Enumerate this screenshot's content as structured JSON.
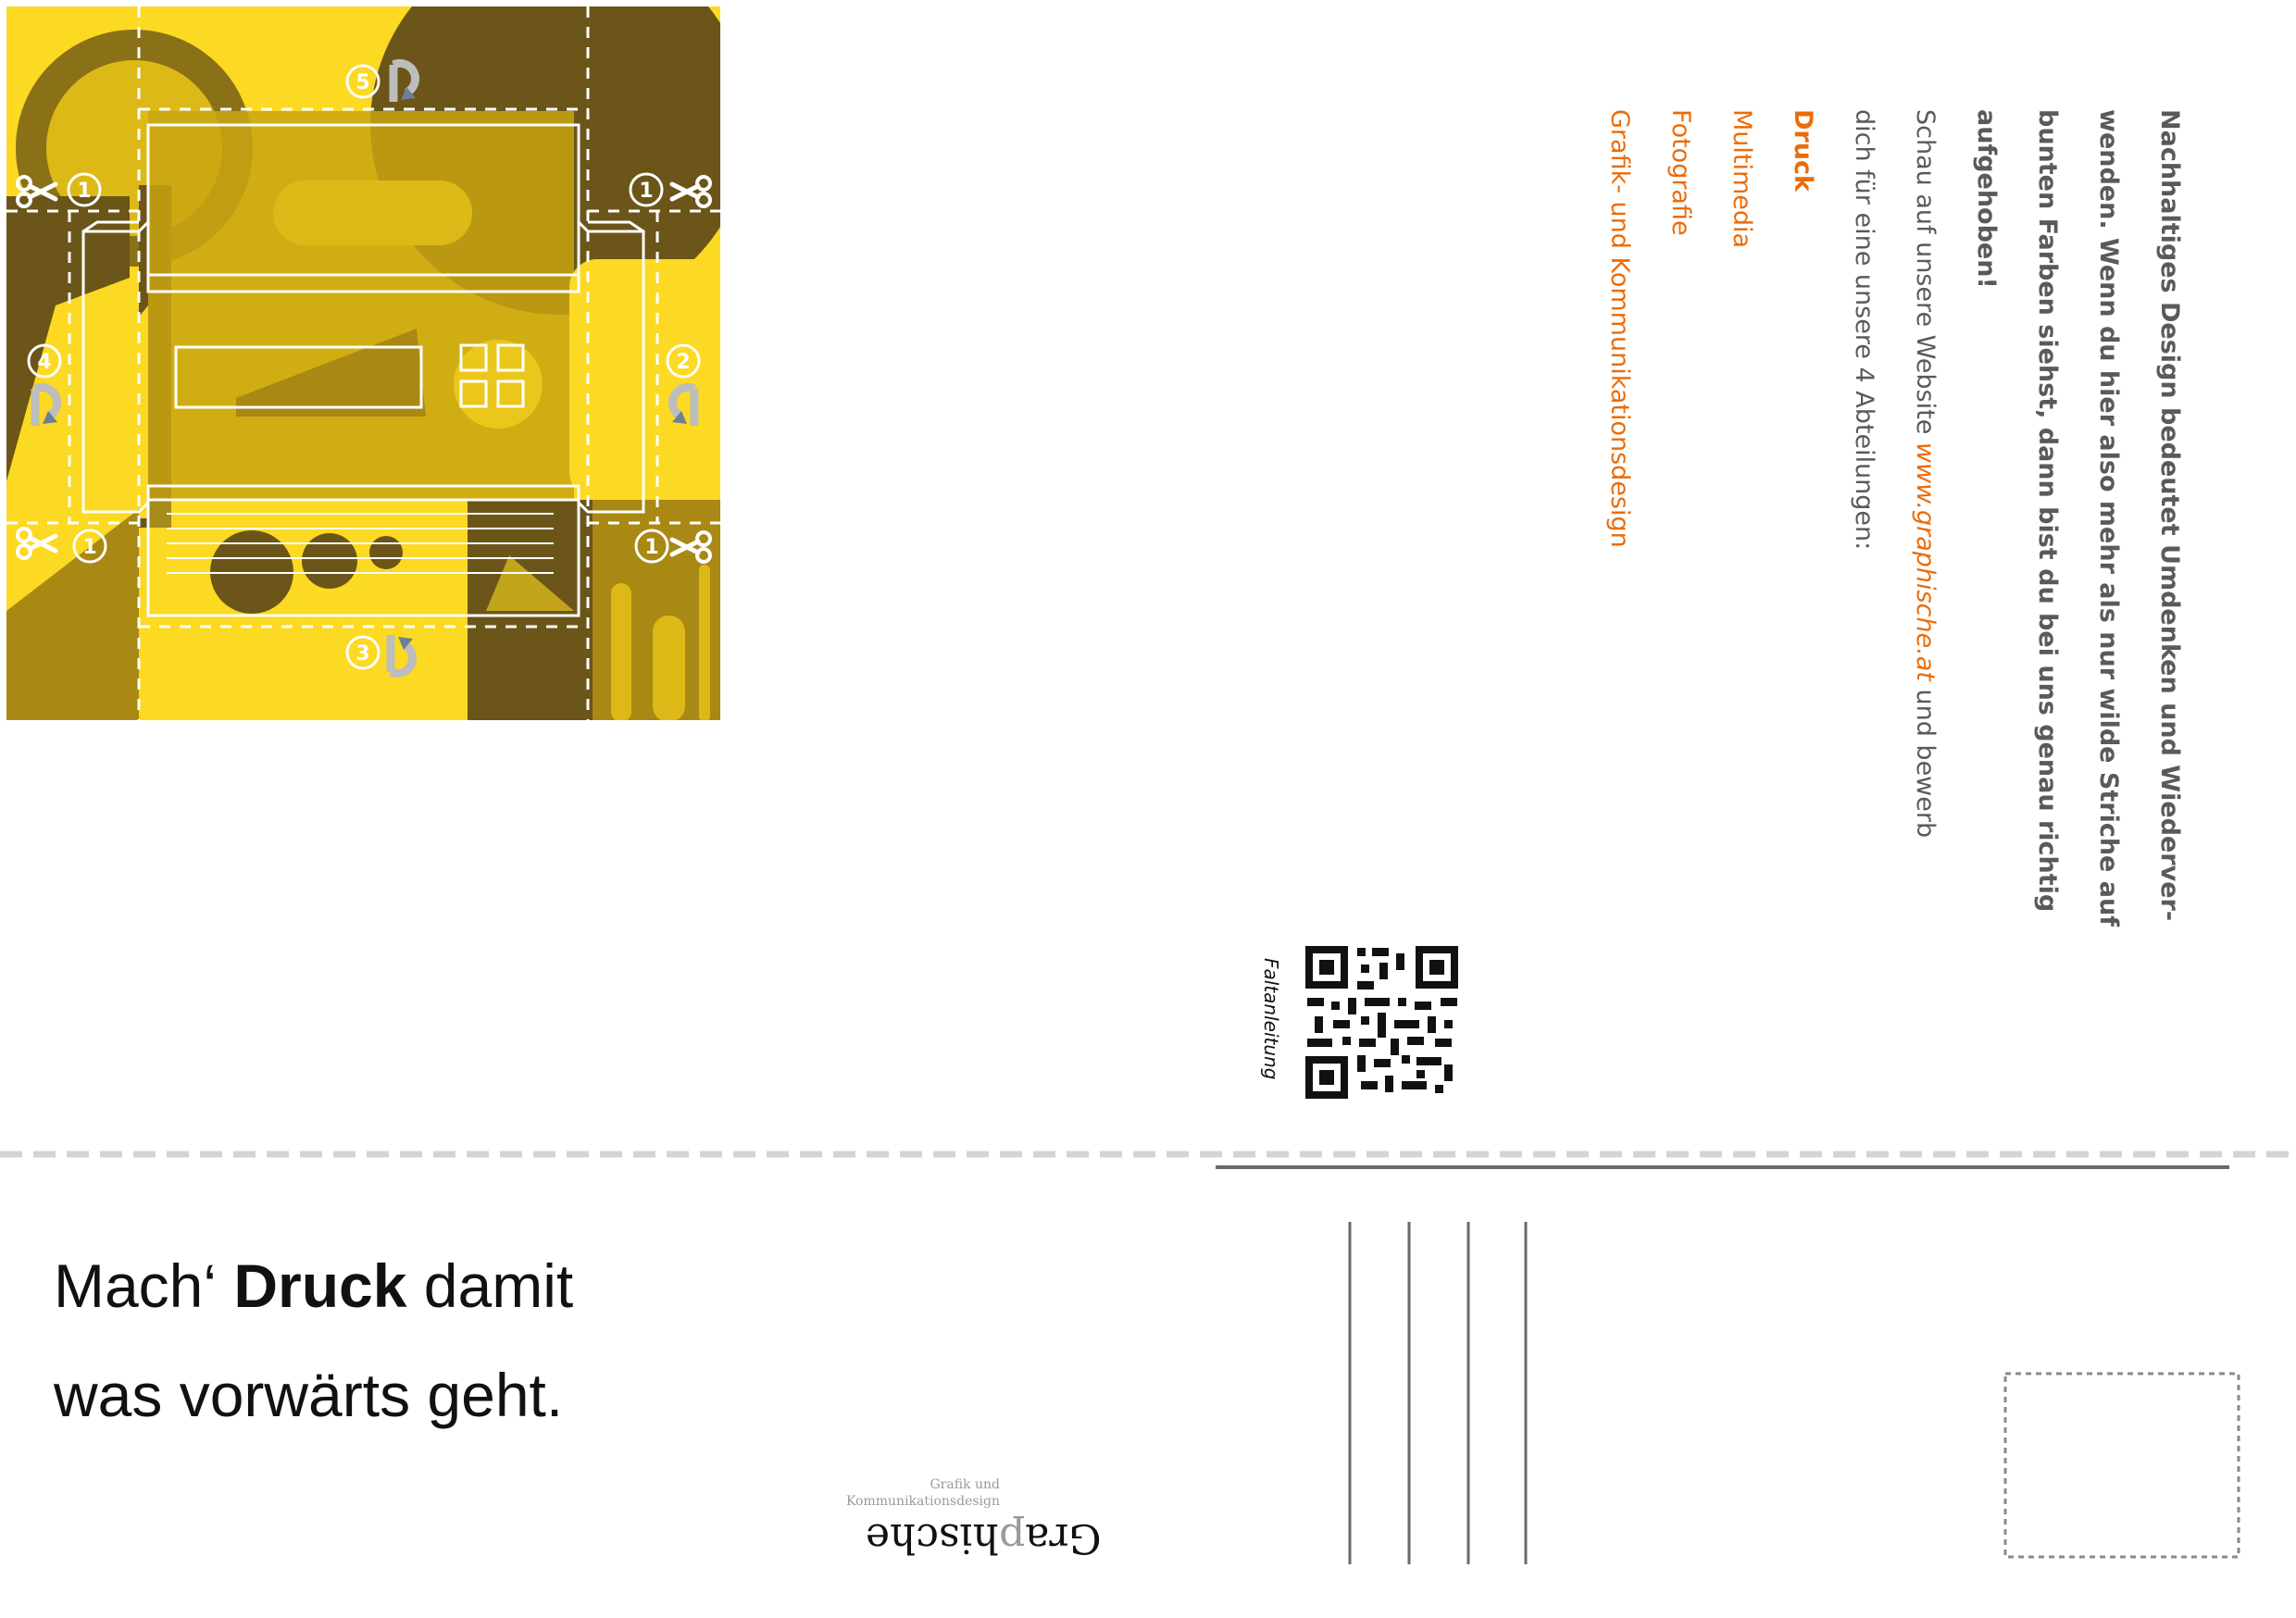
{
  "card_text": {
    "intro_bold": "Nachhaltiges Design bedeutet Umdenken und Wiederver-",
    "intro_bold_2": "wenden. Wenn du hier also mehr als nur wilde Striche auf",
    "intro_bold_3": "bunten Farben siehst, dann bist du bei uns genau richtig",
    "intro_bold_4": "aufgehoben!",
    "website_line_1_pre": "Schau auf unsere Website ",
    "website_url": "www.graphische.at",
    "website_line_1_post": " und bewerb",
    "website_line_2": "dich für eine unsere 4 Abteilungen:",
    "departments": [
      "Druck",
      "Multimedia",
      "Fotografie",
      "Grafik- und Kommunikationsdesign"
    ]
  },
  "qr_label": "Faltanleitung",
  "slogan": {
    "line1_pre": "Mach‘ ",
    "line1_bold": "Druck",
    "line1_post": " damit",
    "line2": "was vorwärts geht."
  },
  "logo": {
    "sub1": "Grafik und",
    "sub2": "Kommunikationsdesign",
    "word_a": "Gra",
    "word_b": "p",
    "word_c": "hische"
  },
  "fold_steps": [
    "1",
    "1",
    "1",
    "1",
    "2",
    "3",
    "4",
    "5"
  ],
  "colors": {
    "yellow": "#fcd922",
    "mid_yellow": "#dcb916",
    "olive": "#a98814",
    "dark_olive": "#6b5518",
    "orange": "#ea6c0a",
    "grey_text": "#5a5a5a"
  },
  "icons": [
    "scissors-icon",
    "fold-arrow-icon",
    "qr-code-icon",
    "stamp-box-icon",
    "logo-icon"
  ]
}
